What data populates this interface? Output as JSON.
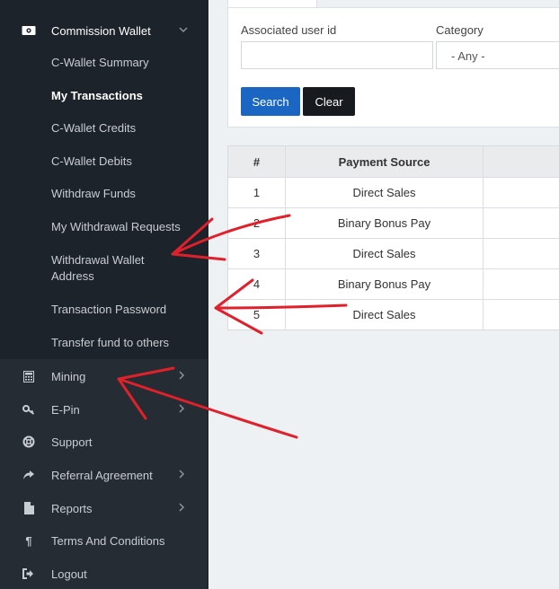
{
  "sidebar": {
    "wallet_header": {
      "label": "Commission Wallet",
      "icon": "wallet-icon"
    },
    "wallet_sub_items": [
      {
        "label": "C-Wallet Summary"
      },
      {
        "label": "My Transactions",
        "active": true
      },
      {
        "label": "C-Wallet Credits"
      },
      {
        "label": "C-Wallet Debits"
      },
      {
        "label": "Withdraw Funds"
      },
      {
        "label": "My Withdrawal Requests"
      },
      {
        "label": "Withdrawal Wallet",
        "label2": "Address"
      },
      {
        "label": "Transaction Password"
      },
      {
        "label": "Transfer fund to others"
      }
    ],
    "items": [
      {
        "label": "Mining",
        "icon": "calculator-icon",
        "has_submenu": true
      },
      {
        "label": "E-Pin",
        "icon": "key-icon",
        "has_submenu": true
      },
      {
        "label": "Support",
        "icon": "life-ring-icon",
        "has_submenu": false
      },
      {
        "label": "Referral Agreement",
        "icon": "share-icon",
        "has_submenu": true
      },
      {
        "label": "Reports",
        "icon": "file-icon",
        "has_submenu": true
      },
      {
        "label": "Terms And Conditions",
        "icon": "paragraph-icon",
        "has_submenu": false
      },
      {
        "label": "Logout",
        "icon": "sign-out-icon",
        "has_submenu": false
      }
    ]
  },
  "filter": {
    "user_id_label": "Associated user id",
    "user_id_value": "",
    "category_label": "Category",
    "category_value": "- Any -",
    "search_label": "Search",
    "clear_label": "Clear"
  },
  "table": {
    "headers": [
      "#",
      "Payment Source",
      ""
    ],
    "rows": [
      [
        "1",
        "Direct Sales",
        ""
      ],
      [
        "2",
        "Binary Bonus Pay",
        ""
      ],
      [
        "3",
        "Direct Sales",
        ""
      ],
      [
        "4",
        "Binary Bonus Pay",
        ""
      ],
      [
        "5",
        "Direct Sales",
        ""
      ]
    ]
  },
  "colors": {
    "sidebar_bg": "#252c33",
    "submenu_bg": "#1d232a",
    "search_button": "#1a66c2",
    "clear_button": "#171b1f",
    "annotation_arrow": "#e0202a"
  }
}
